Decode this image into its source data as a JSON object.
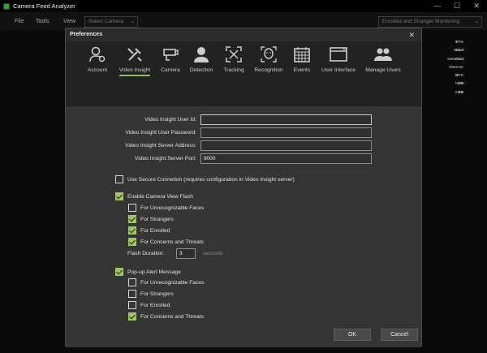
{
  "app": {
    "title": "Camera Feed Analyzer"
  },
  "window_controls": {
    "minimize": "—",
    "maximize": "☐",
    "close": "✕"
  },
  "menu": {
    "file": "File",
    "tools": "Tools",
    "view": "View",
    "camera_select_placeholder": "Select Camera",
    "mode": "Enrolled and Stranger Monitoring"
  },
  "stats": {
    "labels": [
      "FPS:",
      "Video:",
      "Detection:",
      "Detector:",
      "DFS:",
      "dtR:",
      "dtE:"
    ],
    "values": [
      "0",
      "0 x 0",
      "0 x 0",
      "",
      "0",
      "0 ms",
      "0 ms"
    ]
  },
  "dialog": {
    "title": "Preferences",
    "close": "✕"
  },
  "toolbar": {
    "tabs": [
      {
        "label": "Account",
        "icon": "account-icon"
      },
      {
        "label": "Video Insight",
        "icon": "tools-icon",
        "active": true
      },
      {
        "label": "Camera",
        "icon": "camera-icon"
      },
      {
        "label": "Detection",
        "icon": "person-icon"
      },
      {
        "label": "Tracking",
        "icon": "tracking-icon"
      },
      {
        "label": "Recognition",
        "icon": "recognition-icon"
      },
      {
        "label": "Events",
        "icon": "calendar-icon"
      },
      {
        "label": "User Interface",
        "icon": "window-icon"
      },
      {
        "label": "Manage Users",
        "icon": "users-icon"
      }
    ]
  },
  "form": {
    "user_id_label": "Video Insight User Id:",
    "user_id_value": "",
    "password_label": "Video Insight User Password:",
    "password_value": "",
    "server_address_label": "Video Insight Server Address:",
    "server_address_value": "",
    "server_port_label": "Video Insight Server Port:",
    "server_port_value": "9000",
    "secure_connection_label": "Use Secure Connetion (requires configuration in Video Insight server)",
    "secure_connection_checked": false
  },
  "camera_flash": {
    "label": "Enable Camera View Flash",
    "checked": true,
    "options": [
      {
        "label": "For Unrecognizable Faces",
        "checked": false
      },
      {
        "label": "For Strangers",
        "checked": true
      },
      {
        "label": "For Enrolled",
        "checked": true
      },
      {
        "label": "For Concerns and Threats",
        "checked": true
      }
    ],
    "duration_label": "Flash Duration:",
    "duration_value": "3",
    "duration_unit": "seconds"
  },
  "popup_alert": {
    "label": "Pop-up Alert Message",
    "checked": true,
    "options": [
      {
        "label": "For Unrecognizable Faces",
        "checked": false
      },
      {
        "label": "For Strangers",
        "checked": false
      },
      {
        "label": "For Enrolled",
        "checked": false
      },
      {
        "label": "For Concerns and Threats",
        "checked": true
      }
    ]
  },
  "buttons": {
    "ok": "OK",
    "cancel": "Cancel"
  },
  "colors": {
    "accent": "#9ec85e",
    "focus_border": "#c8d86a",
    "dialog_bg": "#353535",
    "toolbar_bg": "#222222"
  }
}
